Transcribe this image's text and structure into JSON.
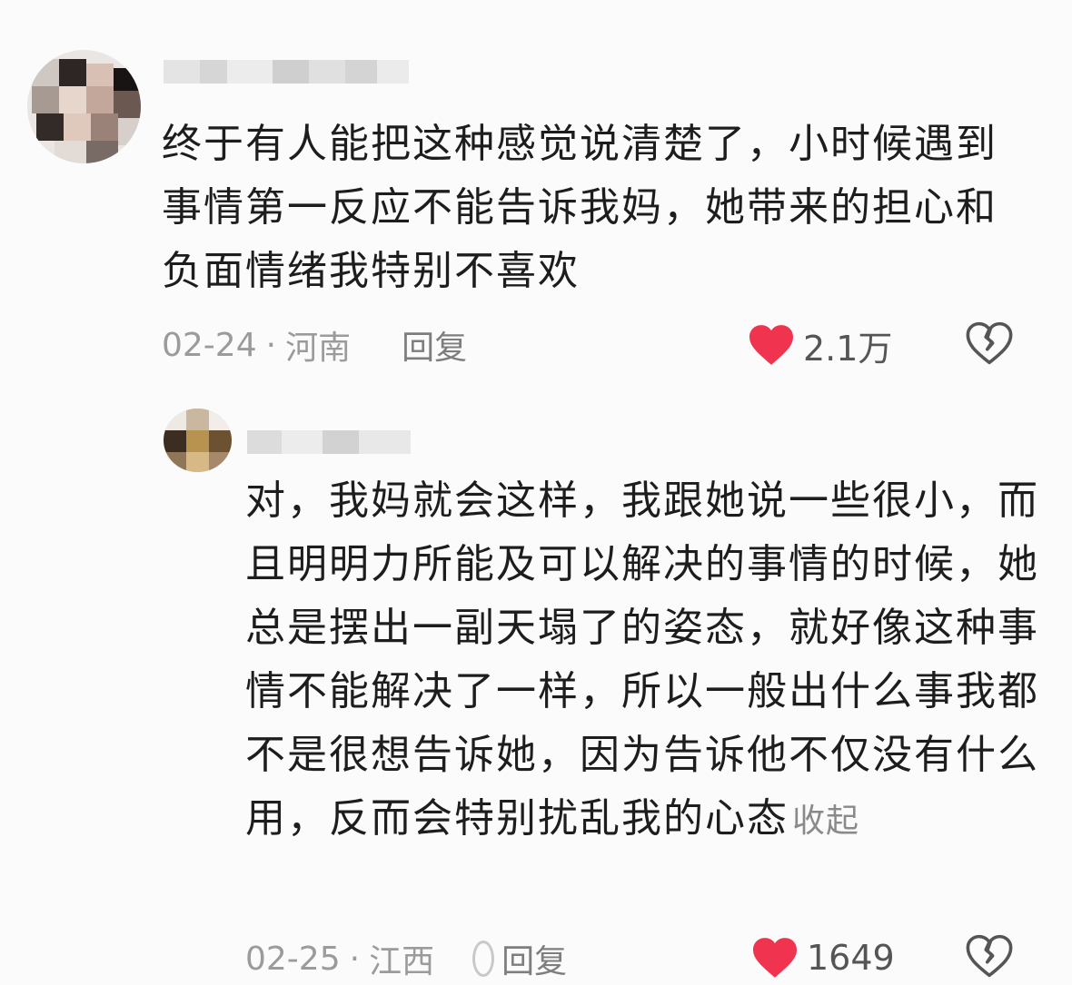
{
  "comments": [
    {
      "text": "终于有人能把这种感觉说清楚了，小时候遇到事情第一反应不能告诉我妈，她带来的担心和负面情绪我特别不喜欢",
      "date": "02-24",
      "separator": "·",
      "location": "河南",
      "reply_label": "回复",
      "likes": "2.1万",
      "icons": {
        "like": "heart-icon",
        "dislike": "broken-heart-icon"
      }
    },
    {
      "text": "对，我妈就会这样，我跟她说一些很小，而且明明力所能及可以解决的事情的时候，她总是摆出一副天塌了的姿态，就好像这种事情不能解决了一样，所以一般出什么事我都不是很想告诉她，因为告诉他不仅没有什么用，反而会特别扰乱我的心态",
      "collapse_label": "收起",
      "date": "02-25",
      "separator": "·",
      "location": "江西",
      "reply_label": "回复",
      "likes": "1649",
      "icons": {
        "like": "heart-icon",
        "dislike": "broken-heart-icon"
      }
    }
  ],
  "colors": {
    "like_red": "#f0344f",
    "meta_gray": "#9b9b9b",
    "text": "#1d1d1d",
    "background": "#fbfbfb"
  }
}
